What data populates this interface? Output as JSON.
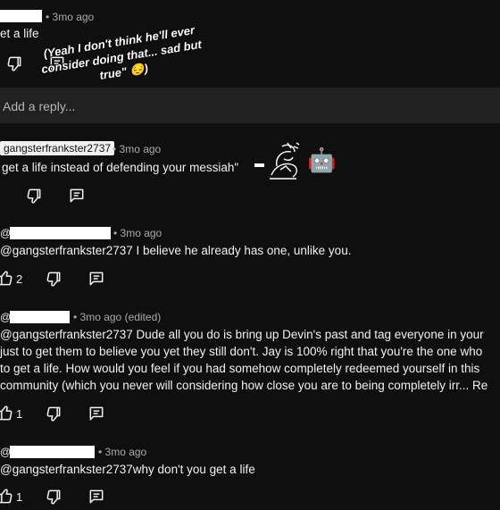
{
  "c1": {
    "time": "• 3mo ago",
    "text": "et a life",
    "overlay_caption": "(Yeah I don't think he'll ever consider doing that... sad but true\" 😔)"
  },
  "reply_input": {
    "placeholder": "Add a reply..."
  },
  "c2": {
    "author": "gangsterfrankster2737",
    "time": "• 3mo ago",
    "text": "get a life instead of defending your messiah\"",
    "robot_emoji": "🤖",
    "sticker_icon": "scribble-sticker-icon"
  },
  "c3": {
    "at": "@",
    "time": "• 3mo ago",
    "text": "@gangsterfrankster2737 I believe he already has one, unlike you.",
    "likes": "2"
  },
  "c4": {
    "at": "@",
    "time": "• 3mo ago (edited)",
    "lines": [
      "@gangsterfrankster2737 Dude all you do is bring up Devin's past and tag everyone in your",
      "just to get them to believe you yet they still don't. Jay is 100% right that you're the one who",
      "to get a life. How would you feel if you had somehow completely redeemed yourself in this",
      "community (which you never will considering how close you are to being completely irr... Re"
    ],
    "likes": "1"
  },
  "c5": {
    "at": "@",
    "time": "• 3mo ago",
    "text": "@gangsterfrankster2737why don't you get a life",
    "likes": "1"
  },
  "colors": {
    "background": "#0f0f0f",
    "input_strip": "#212121",
    "text": "#f1f1f1",
    "meta": "#aaaaaa"
  }
}
